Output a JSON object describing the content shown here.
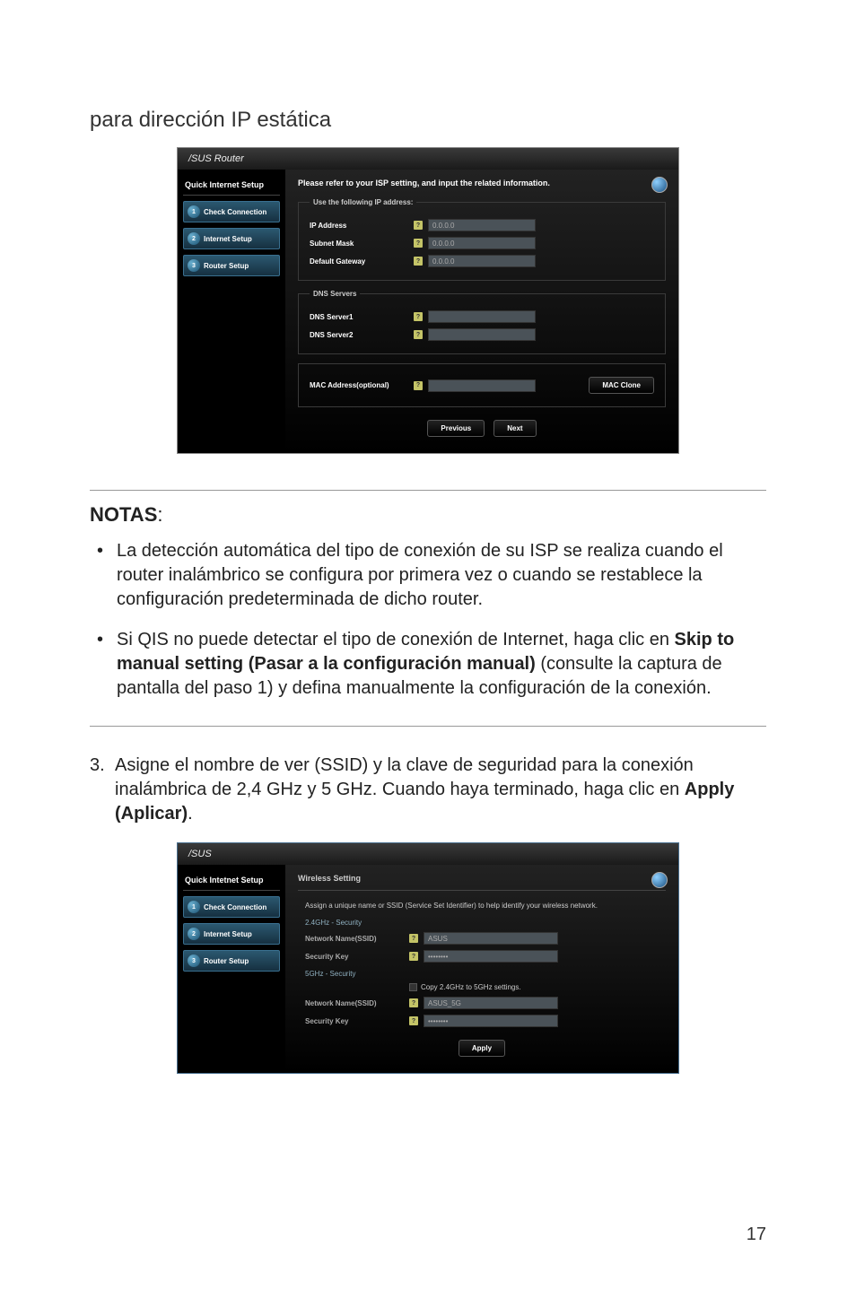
{
  "heading": "para dirección IP estática",
  "panel1": {
    "brand": "/SUS Router",
    "sidebar_title": "Quick Internet Setup",
    "steps": [
      "Check Connection",
      "Internet Setup",
      "Router Setup"
    ],
    "main_heading": "Please refer to your ISP setting, and input the related information.",
    "fieldset1_legend": "Use the following IP address:",
    "ip_address_label": "IP Address",
    "ip_address_value": "0.0.0.0",
    "subnet_label": "Subnet Mask",
    "subnet_value": "0.0.0.0",
    "gateway_label": "Default Gateway",
    "gateway_value": "0.0.0.0",
    "fieldset2_legend": "DNS Servers",
    "dns1_label": "DNS Server1",
    "dns2_label": "DNS Server2",
    "mac_label": "MAC Address(optional)",
    "mac_clone_btn": "MAC Clone",
    "prev_btn": "Previous",
    "next_btn": "Next"
  },
  "notas": {
    "title_bold": "NOTAS",
    "title_after": ":",
    "bullet1": "La detección automática del tipo de conexión de su ISP se realiza cuando el router inalámbrico se configura por primera vez o cuando se restablece la configuración predeterminada de dicho router.",
    "bullet2_before": "Si QIS no puede detectar el tipo de conexión de Internet, haga clic en ",
    "bullet2_bold": "Skip to manual setting (Pasar a la configuración manual)",
    "bullet2_after": " (consulte la captura de pantalla del paso 1) y defina manualmente la configuración de la conexión."
  },
  "step3": {
    "num": "3.",
    "text_before": "Asigne el nombre de ver (SSID) y la clave de seguridad para la conexión inalámbrica de 2,4 GHz y 5 GHz. Cuando haya terminado, haga clic en ",
    "text_bold": "Apply (Aplicar)",
    "text_after": "."
  },
  "panel2": {
    "brand": "/SUS",
    "sidebar_title": "Quick Intetnet Setup",
    "steps": [
      "Check Connection",
      "Internet Setup",
      "Router Setup"
    ],
    "main_heading": "Wireless Setting",
    "desc": "Assign a unique name or SSID (Service Set Identifier) to help identify your wireless network.",
    "sec24": "2.4GHz - Security",
    "ssid_label": "Network Name(SSID)",
    "ssid24_value": "ASUS",
    "seckey_label": "Security Key",
    "sec5": "5GHz - Security",
    "copy_label": "Copy 2.4GHz to 5GHz settings.",
    "ssid5_value": "ASUS_5G",
    "apply_btn": "Apply"
  },
  "page_number": "17"
}
